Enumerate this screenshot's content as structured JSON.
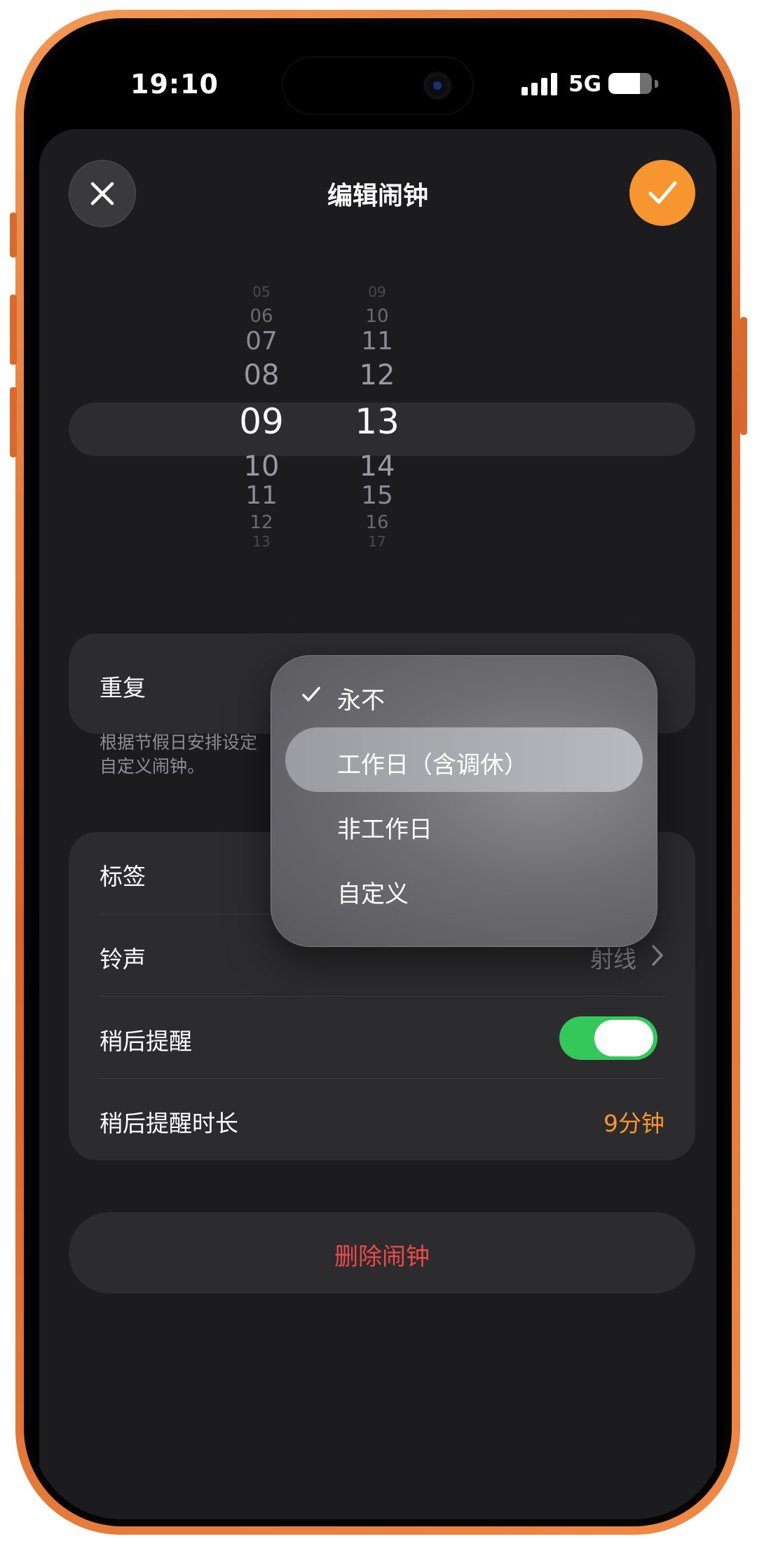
{
  "status_bar": {
    "time": "19:10",
    "network": "5G",
    "battery_level": 0.72
  },
  "header": {
    "title": "编辑闹钟"
  },
  "time_picker": {
    "hours": [
      "05",
      "06",
      "07",
      "08",
      "09",
      "10",
      "11",
      "12",
      "13"
    ],
    "minutes": [
      "09",
      "10",
      "11",
      "12",
      "13",
      "14",
      "15",
      "16",
      "17"
    ],
    "selected_hour": "09",
    "selected_minute": "13"
  },
  "repeat": {
    "label": "重复",
    "note_line1": "根据节假日安排设定",
    "note_line2": "自定义闹钟。"
  },
  "settings": {
    "label_row": "标签",
    "sound_row": "铃声",
    "sound_value": "射线",
    "snooze_row": "稍后提醒",
    "snooze_on": true,
    "snooze_duration_row": "稍后提醒时长",
    "snooze_duration_value": "9分钟"
  },
  "delete_button": "删除闹钟",
  "repeat_menu": {
    "options": [
      "永不",
      "工作日（含调休）",
      "非工作日",
      "自定义"
    ],
    "checked_index": 0,
    "highlighted_index": 1
  },
  "colors": {
    "accent": "#f7962e",
    "toggle_on": "#34c759",
    "destructive": "#eb4a4a",
    "frame": "#e9782f"
  },
  "icons": [
    "close-icon",
    "checkmark-icon",
    "chevron-right-icon",
    "signal-icon",
    "battery-icon"
  ]
}
